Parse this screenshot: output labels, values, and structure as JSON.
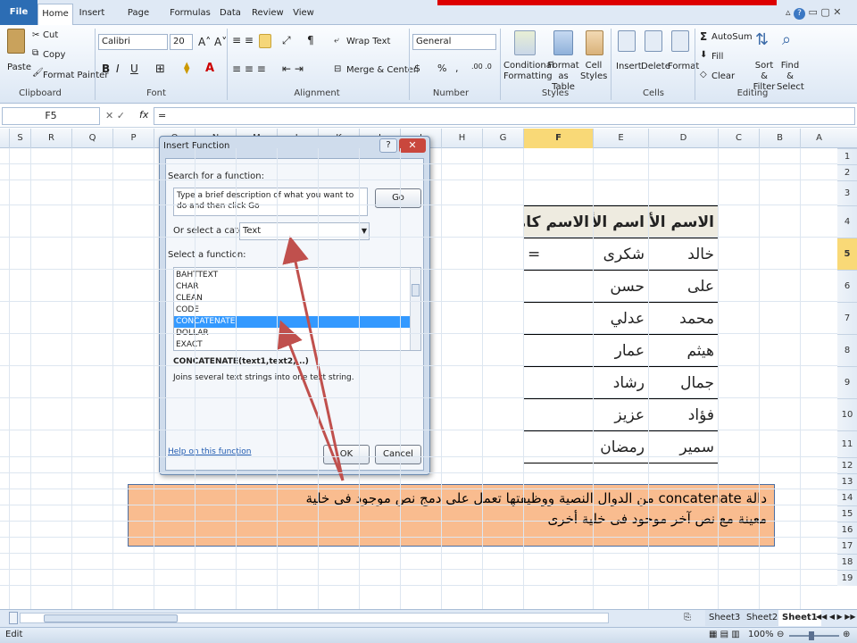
{
  "tabs": [
    "File",
    "Home",
    "Insert",
    "Page Layout",
    "Formulas",
    "Data",
    "Review",
    "View"
  ],
  "ribbon": {
    "clipboard": {
      "paste": "Paste",
      "cut": "Cut",
      "copy": "Copy",
      "format_painter": "Format Painter",
      "label": "Clipboard"
    },
    "font": {
      "name": "Calibri",
      "size": "20",
      "bold": "B",
      "italic": "I",
      "underline": "U",
      "label": "Font"
    },
    "alignment": {
      "wrap": "Wrap Text",
      "merge": "Merge & Center",
      "label": "Alignment"
    },
    "number": {
      "format": "General",
      "currency": "$",
      "percent": "%",
      "comma": ",",
      "label": "Number"
    },
    "styles": {
      "conditional": "Conditional Formatting",
      "format_table": "Format as Table",
      "cell_styles": "Cell Styles",
      "label": "Styles"
    },
    "cells": {
      "insert": "Insert",
      "delete": "Delete",
      "format": "Format",
      "label": "Cells"
    },
    "editing": {
      "autosum": "AutoSum",
      "fill": "Fill",
      "clear": "Clear",
      "sort": "Sort & Filter",
      "find": "Find & Select",
      "label": "Editing"
    }
  },
  "formula_bar": {
    "name_box": "F5",
    "fx": "fx",
    "content": "="
  },
  "columns": [
    "S",
    "R",
    "Q",
    "P",
    "O",
    "N",
    "M",
    "L",
    "K",
    "J",
    "I",
    "H",
    "G",
    "F",
    "E",
    "D",
    "C",
    "B",
    "A"
  ],
  "rows": [
    "1",
    "2",
    "3",
    "4",
    "5",
    "6",
    "7",
    "8",
    "9",
    "10",
    "11",
    "12",
    "13",
    "14",
    "15",
    "16",
    "17",
    "18",
    "19"
  ],
  "table": {
    "headers": [
      "الاسم كاملاً",
      "اسم الأب",
      "الاسم الأول"
    ],
    "rows": [
      [
        "=",
        "شكرى",
        "خالد"
      ],
      [
        "",
        "حسن",
        "على"
      ],
      [
        "",
        "عدلي",
        "محمد"
      ],
      [
        "",
        "عمار",
        "هيثم"
      ],
      [
        "",
        "رشاد",
        "جمال"
      ],
      [
        "",
        "عزيز",
        "فؤاد"
      ],
      [
        "",
        "رمضان",
        "سمير"
      ]
    ]
  },
  "dialog": {
    "title": "Insert Function",
    "search_label": "Search for a function:",
    "search_text": "Type a brief description of what you want to do and then click Go",
    "go": "Go",
    "category_label": "Or select a category:",
    "category": "Text",
    "select_label": "Select a function:",
    "functions": [
      "BAHTTEXT",
      "CHAR",
      "CLEAN",
      "CODE",
      "CONCATENATE",
      "DOLLAR",
      "EXACT"
    ],
    "selected": "CONCATENATE",
    "signature": "CONCATENATE(text1,text2,...)",
    "description": "Joins several text strings into one text string.",
    "help": "Help on this function",
    "ok": "OK",
    "cancel": "Cancel"
  },
  "callout": {
    "line1": "دالة concatenate من الدوال النصية   ووظيفتها تعمل على دمج نص موجود فى خلية",
    "line2": "معينة مع نص آخر موجود فى خلية أخرى"
  },
  "sheets": [
    "Sheet3",
    "Sheet2",
    "Sheet1"
  ],
  "status": {
    "mode": "Edit",
    "zoom": "100%"
  },
  "colors": {
    "callout": "#f9bc8f",
    "header_fill": "#eeebe0",
    "selection": "#3399ff",
    "arrow": "#c0504d"
  }
}
